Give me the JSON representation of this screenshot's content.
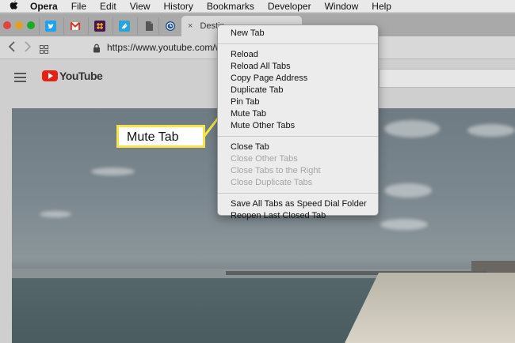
{
  "menubar": {
    "apple": "",
    "items": [
      "Opera",
      "File",
      "Edit",
      "View",
      "History",
      "Bookmarks",
      "Developer",
      "Window",
      "Help"
    ]
  },
  "tabs": {
    "pinned_icons": [
      "twitter-icon",
      "gmail-icon",
      "slack-icon",
      "feedly-icon",
      "document-icon",
      "clock-icon"
    ],
    "active_tab_label": "Destin",
    "close_glyph": "×"
  },
  "addressbar": {
    "url": "https://www.youtube.com/w"
  },
  "page": {
    "logo_text": "YouTube"
  },
  "context_menu": {
    "group1": [
      "New Tab"
    ],
    "group2": [
      "Reload",
      "Reload All Tabs",
      "Copy Page Address",
      "Duplicate Tab",
      "Pin Tab",
      "Mute Tab",
      "Mute Other Tabs"
    ],
    "group3": [
      {
        "label": "Close Tab",
        "enabled": true
      },
      {
        "label": "Close Other Tabs",
        "enabled": false
      },
      {
        "label": "Close Tabs to the Right",
        "enabled": false
      },
      {
        "label": "Close Duplicate Tabs",
        "enabled": false
      }
    ],
    "group4": [
      "Save All Tabs as Speed Dial Folder",
      "Reopen Last Closed Tab"
    ]
  },
  "callout": {
    "label": "Mute Tab",
    "color": "#f4e64a"
  },
  "colors": {
    "twitter": "#1da1f2",
    "gmail": "#d93025",
    "slack": "#4a154b",
    "youtube_red": "#e62117"
  }
}
